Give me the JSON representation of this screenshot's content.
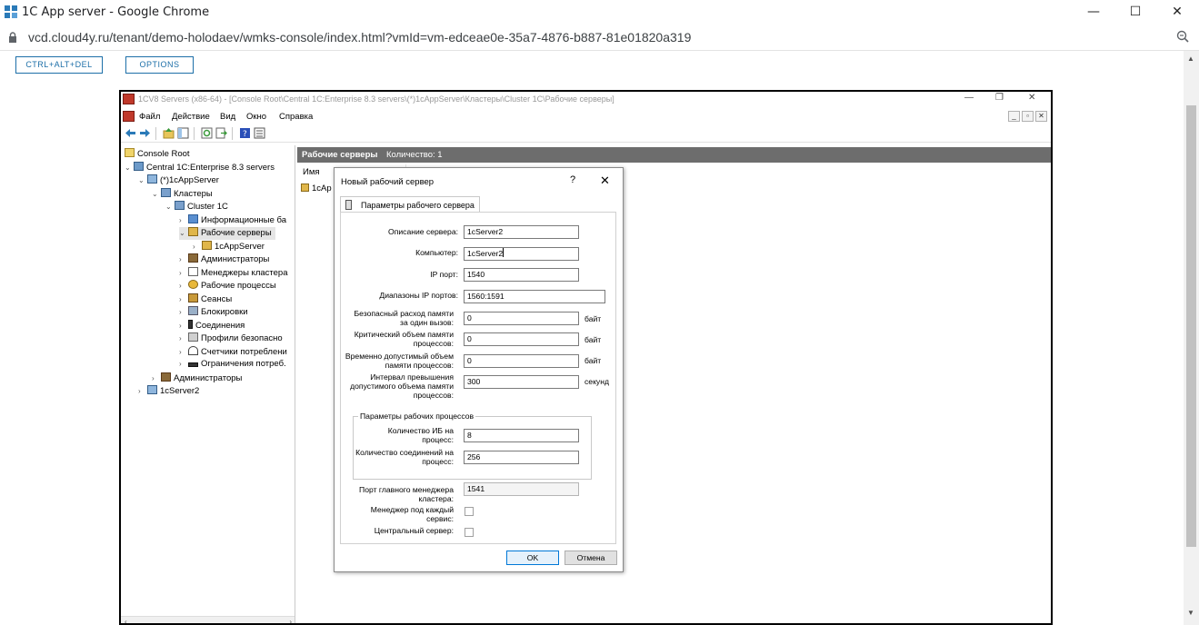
{
  "browser": {
    "window_title": "1C App server - Google Chrome",
    "url": "vcd.cloud4y.ru/tenant/demo-holodaev/wmks-console/index.html?vmId=vm-edceae0e-35a7-4876-b887-81e01820a319",
    "minimize": "—",
    "maximize": "☐",
    "close": "✕"
  },
  "console_toolbar": {
    "ctrl_alt_del": "CTRL+ALT+DEL",
    "options": "OPTIONS"
  },
  "mmc": {
    "title": "1CV8 Servers (x86-64) - [Console Root\\Central 1C:Enterprise 8.3 servers\\(*)1cAppServer\\Кластеры\\Cluster 1C\\Рабочие серверы]",
    "menu": [
      "Файл",
      "Действие",
      "Вид",
      "Окно",
      "Справка"
    ],
    "tree": [
      {
        "label": "Console Root",
        "arrow": ""
      },
      {
        "label": "Central 1C:Enterprise 8.3 servers",
        "arrow": "⌄"
      },
      {
        "label": "(*)1cAppServer",
        "arrow": "⌄"
      },
      {
        "label": "Кластеры",
        "arrow": "⌄"
      },
      {
        "label": "Cluster 1C",
        "arrow": "⌄"
      },
      {
        "label": "Информационные ба",
        "arrow": "›"
      },
      {
        "label": "Рабочие серверы",
        "arrow": "⌄"
      },
      {
        "label": "1cAppServer",
        "arrow": "›"
      },
      {
        "label": "Администраторы",
        "arrow": "›"
      },
      {
        "label": "Менеджеры кластера",
        "arrow": "›"
      },
      {
        "label": "Рабочие процессы",
        "arrow": "›"
      },
      {
        "label": "Сеансы",
        "arrow": "›"
      },
      {
        "label": "Блокировки",
        "arrow": "›"
      },
      {
        "label": "Соединения",
        "arrow": "›"
      },
      {
        "label": "Профили безопасно",
        "arrow": "›"
      },
      {
        "label": "Счетчики потреблени",
        "arrow": "›"
      },
      {
        "label": "Ограничения потреб.",
        "arrow": "›"
      },
      {
        "label": "Администраторы",
        "arrow": "›"
      },
      {
        "label": "1cServer2",
        "arrow": "›"
      }
    ],
    "result_header": {
      "title": "Рабочие серверы",
      "count": "Количество: 1"
    },
    "column": "Имя",
    "row": "1cAp"
  },
  "dialog": {
    "title": "Новый рабочий сервер",
    "help": "?",
    "close": "✕",
    "tab": "Параметры рабочего сервера",
    "fields": {
      "description_label": "Описание сервера:",
      "description_value": "1cServer2",
      "computer_label": "Компьютер:",
      "computer_value": "1cServer2",
      "ip_port_label": "IP порт:",
      "ip_port_value": "1540",
      "ip_ranges_label": "Диапазоны IP портов:",
      "ip_ranges_value": "1560:1591",
      "safe_mem_label": "Безопасный расход памяти за один вызов:",
      "safe_mem_value": "0",
      "safe_mem_unit": "байт",
      "critical_mem_label": "Критический объем памяти процессов:",
      "critical_mem_value": "0",
      "critical_mem_unit": "байт",
      "temp_mem_label": "Временно допустимый объем памяти процессов:",
      "temp_mem_value": "0",
      "temp_mem_unit": "байт",
      "interval_label": "Интервал превышения допустимого объема памяти процессов:",
      "interval_value": "300",
      "interval_unit": "секунд",
      "group_label": "Параметры рабочих процессов",
      "ib_per_process_label": "Количество ИБ на процесс:",
      "ib_per_process_value": "8",
      "conn_per_process_label": "Количество соединений на процесс:",
      "conn_per_process_value": "256",
      "main_port_label": "Порт главного менеджера кластера:",
      "main_port_value": "1541",
      "manager_per_service_label": "Менеджер под каждый сервис:",
      "central_server_label": "Центральный сервер:"
    },
    "ok": "OK",
    "cancel": "Отмена"
  },
  "colors": {
    "header_gray": "#6d6d6d",
    "link_blue": "#1d6fa8",
    "ok_border": "#0078d7"
  }
}
